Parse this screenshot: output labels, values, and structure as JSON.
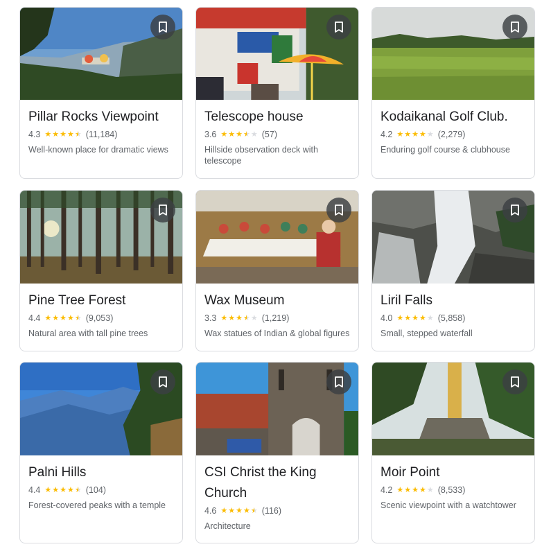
{
  "accent": "#fbbc04",
  "places": [
    {
      "name": "Pillar Rocks Viewpoint",
      "rating": "4.3",
      "reviews": "(11,184)",
      "stars": 4.3,
      "description": "Well-known place for dramatic views"
    },
    {
      "name": "Telescope house",
      "rating": "3.6",
      "reviews": "(57)",
      "stars": 3.6,
      "description": "Hillside observation deck with telescope"
    },
    {
      "name": "Kodaikanal Golf Club.",
      "rating": "4.2",
      "reviews": "(2,279)",
      "stars": 4.2,
      "description": "Enduring golf course & clubhouse"
    },
    {
      "name": "Pine Tree Forest",
      "rating": "4.4",
      "reviews": "(9,053)",
      "stars": 4.4,
      "description": "Natural area with tall pine trees"
    },
    {
      "name": "Wax Museum",
      "rating": "3.3",
      "reviews": "(1,219)",
      "stars": 3.3,
      "description": "Wax statues of Indian & global figures"
    },
    {
      "name": "Liril Falls",
      "rating": "4.0",
      "reviews": "(5,858)",
      "stars": 4.0,
      "description": "Small, stepped waterfall"
    },
    {
      "name": "Palni Hills",
      "rating": "4.4",
      "reviews": "(104)",
      "stars": 4.4,
      "description": "Forest-covered peaks with a temple"
    },
    {
      "name": "CSI Christ the King Church",
      "rating": "4.6",
      "reviews": "(116)",
      "stars": 4.6,
      "description": "Architecture"
    },
    {
      "name": "Moir Point",
      "rating": "4.2",
      "reviews": "(8,533)",
      "stars": 4.2,
      "description": "Scenic viewpoint with a watchtower"
    }
  ]
}
